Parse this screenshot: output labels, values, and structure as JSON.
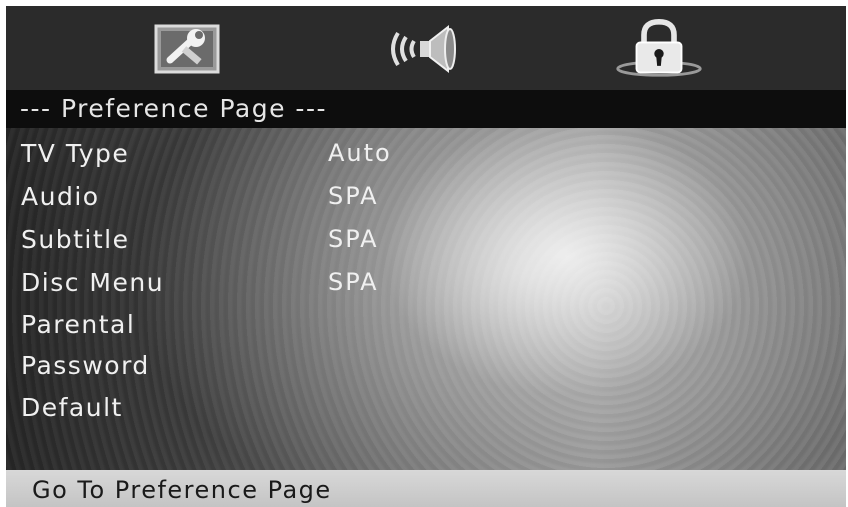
{
  "icons": [
    {
      "name": "setup-wrench-icon"
    },
    {
      "name": "audio-speaker-icon"
    },
    {
      "name": "lock-icon"
    }
  ],
  "header": {
    "title": "--- Preference Page ---"
  },
  "menu": {
    "items": [
      {
        "label": "TV Type",
        "value": "Auto"
      },
      {
        "label": "Audio",
        "value": "SPA"
      },
      {
        "label": "Subtitle",
        "value": "SPA"
      },
      {
        "label": "Disc Menu",
        "value": "SPA"
      },
      {
        "label": "Parental",
        "value": ""
      },
      {
        "label": "Password",
        "value": ""
      },
      {
        "label": "Default",
        "value": ""
      }
    ]
  },
  "status": {
    "text": "Go To Preference Page"
  }
}
